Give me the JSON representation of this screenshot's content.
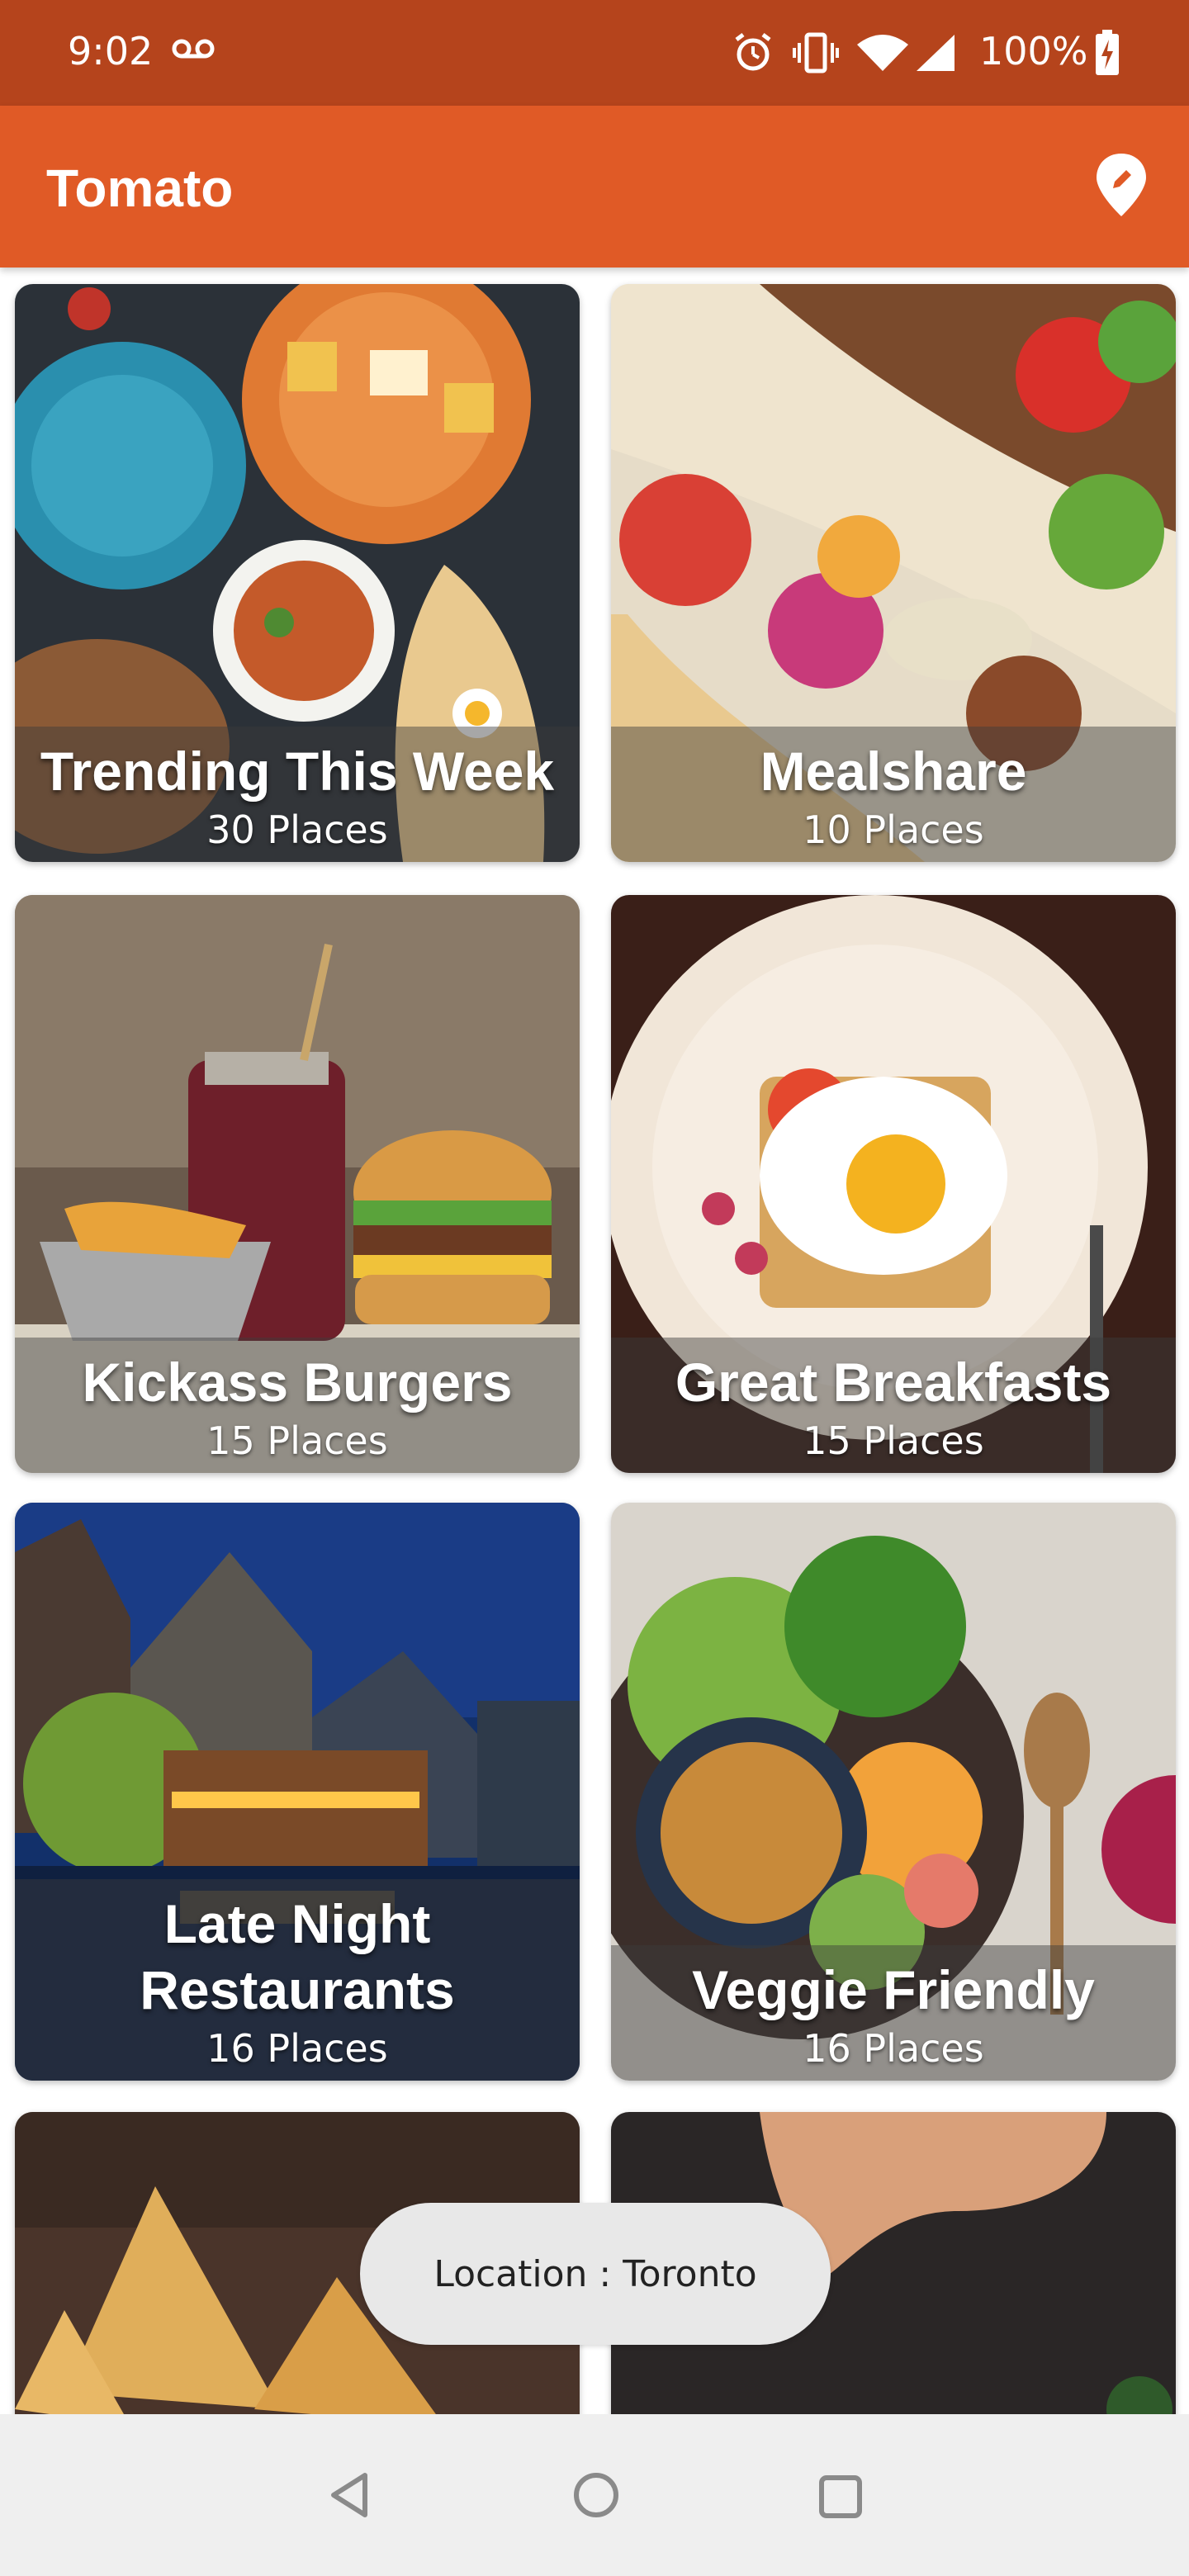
{
  "status_bar": {
    "time": "9:02",
    "battery": "100%",
    "icons": [
      "voicemail-icon",
      "alarm-icon",
      "vibrate-icon",
      "wifi-icon",
      "signal-icon",
      "battery-icon"
    ]
  },
  "app_bar": {
    "title": "Tomato",
    "action_icon": "location-pin-icon",
    "color": "#e05a26"
  },
  "collections": [
    {
      "title": "Trending This Week",
      "subtitle": "30 Places"
    },
    {
      "title": "Mealshare",
      "subtitle": "10 Places"
    },
    {
      "title": "Kickass Burgers",
      "subtitle": "15 Places"
    },
    {
      "title": "Great Breakfasts",
      "subtitle": "15 Places"
    },
    {
      "title": "Late Night Restaurants",
      "subtitle": "16 Places"
    },
    {
      "title": "Veggie Friendly",
      "subtitle": "16 Places"
    },
    {
      "title": "",
      "subtitle": ""
    },
    {
      "title": "",
      "subtitle": ""
    }
  ],
  "toast": {
    "text": "Location : Toronto"
  },
  "nav_bar": {
    "icons": [
      "back-icon",
      "home-icon",
      "recents-icon"
    ]
  },
  "colors": {
    "status_bar": "#b5441c",
    "app_bar": "#e05a26",
    "toast_bg": "#e8e8e8",
    "nav_bar": "#efefef"
  }
}
